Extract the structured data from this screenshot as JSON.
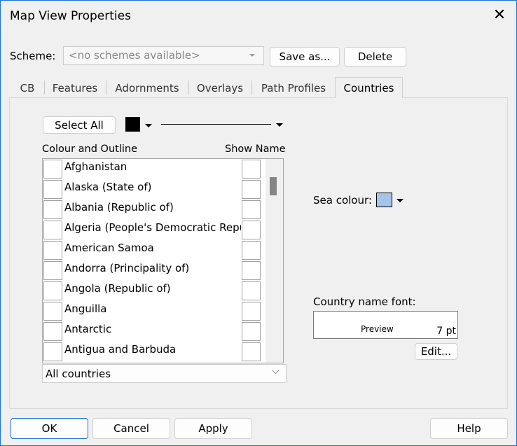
{
  "window": {
    "title": "Map View Properties",
    "close_icon": "close-icon"
  },
  "scheme": {
    "label": "Scheme:",
    "placeholder": "<no schemes available>",
    "save_as": "Save as...",
    "delete": "Delete"
  },
  "tabs": [
    {
      "label": "CB"
    },
    {
      "label": "Features"
    },
    {
      "label": "Adornments"
    },
    {
      "label": "Overlays"
    },
    {
      "label": "Path Profiles"
    },
    {
      "label": "Countries",
      "active": true
    }
  ],
  "countries": {
    "select_all": "Select All",
    "colour_swatch": "#000000",
    "col_colour": "Colour and Outline",
    "col_show": "Show Name",
    "items": [
      "Afghanistan",
      "Alaska (State of)",
      "Albania (Republic of)",
      "Algeria (People's Democratic Republic of)",
      "American Samoa",
      "Andorra (Principality of)",
      "Angola (Republic of)",
      "Anguilla",
      "Antarctic",
      "Antigua and Barbuda"
    ],
    "filter": "All countries",
    "sea_label": "Sea colour:",
    "sea_colour": "#a4c4ec",
    "font_label": "Country name font:",
    "preview": "Preview",
    "font_size": "7 pt",
    "edit": "Edit..."
  },
  "footer": {
    "ok": "OK",
    "cancel": "Cancel",
    "apply": "Apply",
    "help": "Help"
  }
}
